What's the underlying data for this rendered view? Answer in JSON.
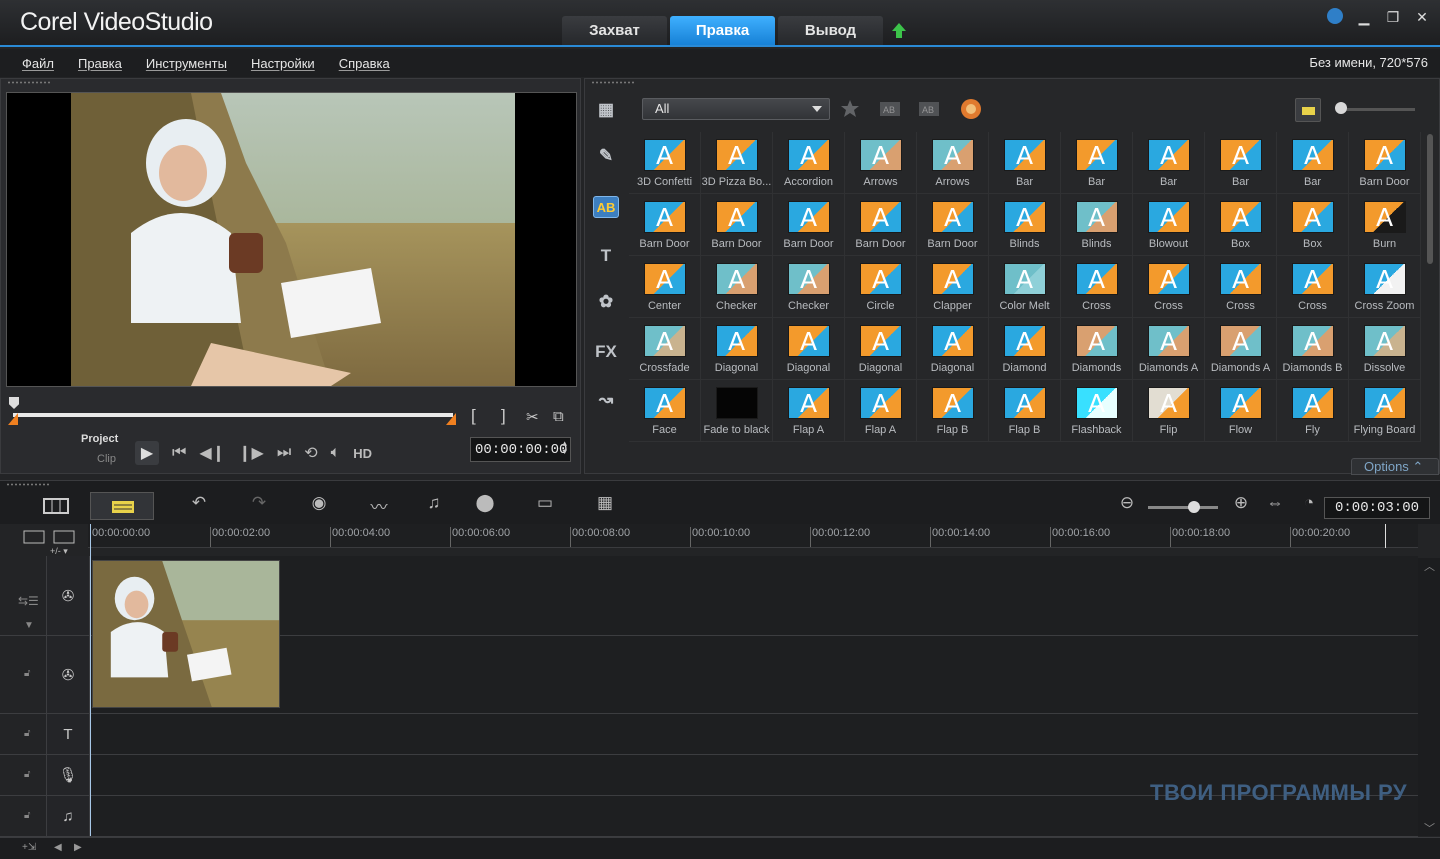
{
  "app": {
    "logo": "Corel VideoStudio"
  },
  "tabs": [
    {
      "label": "Захват"
    },
    {
      "label": "Правка"
    },
    {
      "label": "Вывод"
    }
  ],
  "menu": {
    "items": [
      "Файл",
      "Правка",
      "Инструменты",
      "Настройки",
      "Справка"
    ],
    "project_info": "Без имени, 720*576"
  },
  "player": {
    "project_label": "Project",
    "clip_label": "Clip",
    "hd_label": "HD",
    "timecode": "00:00:00:00",
    "brackets": [
      "[",
      "]"
    ]
  },
  "library": {
    "filter": "All",
    "options_label": "Options",
    "items": [
      {
        "label": "3D Confetti",
        "bg": "#2aa8e0",
        "fg": "#f39a2c"
      },
      {
        "label": "3D Pizza Bo...",
        "bg": "#f39a2c",
        "fg": "#2aa8e0"
      },
      {
        "label": "Accordion",
        "bg": "#2aa8e0",
        "fg": "#f39a2c"
      },
      {
        "label": "Arrows",
        "bg": "#6fbfc9",
        "fg": "#d9a070"
      },
      {
        "label": "Arrows",
        "bg": "#6fbfc9",
        "fg": "#d9a070"
      },
      {
        "label": "Bar",
        "bg": "#2aa8e0",
        "fg": "#f39a2c"
      },
      {
        "label": "Bar",
        "bg": "#f39a2c",
        "fg": "#2aa8e0"
      },
      {
        "label": "Bar",
        "bg": "#2aa8e0",
        "fg": "#f39a2c"
      },
      {
        "label": "Bar",
        "bg": "#f39a2c",
        "fg": "#2aa8e0"
      },
      {
        "label": "Bar",
        "bg": "#2aa8e0",
        "fg": "#f39a2c"
      },
      {
        "label": "Barn Door",
        "bg": "#f39a2c",
        "fg": "#2aa8e0"
      },
      {
        "label": "Barn Door",
        "bg": "#2aa8e0",
        "fg": "#f39a2c"
      },
      {
        "label": "Barn Door",
        "bg": "#f39a2c",
        "fg": "#2aa8e0"
      },
      {
        "label": "Barn Door",
        "bg": "#2aa8e0",
        "fg": "#f39a2c"
      },
      {
        "label": "Barn Door",
        "bg": "#f39a2c",
        "fg": "#2aa8e0"
      },
      {
        "label": "Barn Door",
        "bg": "#f39a2c",
        "fg": "#2aa8e0"
      },
      {
        "label": "Blinds",
        "bg": "#2aa8e0",
        "fg": "#f39a2c"
      },
      {
        "label": "Blinds",
        "bg": "#6fbfc9",
        "fg": "#d9a070"
      },
      {
        "label": "Blowout",
        "bg": "#2aa8e0",
        "fg": "#f39a2c"
      },
      {
        "label": "Box",
        "bg": "#f39a2c",
        "fg": "#2aa8e0"
      },
      {
        "label": "Box",
        "bg": "#f39a2c",
        "fg": "#2aa8e0"
      },
      {
        "label": "Burn",
        "bg": "#f39a2c",
        "fg": "#1a1a1a"
      },
      {
        "label": "Center",
        "bg": "#f39a2c",
        "fg": "#2aa8e0"
      },
      {
        "label": "Checker",
        "bg": "#6fbfc9",
        "fg": "#d9a070"
      },
      {
        "label": "Checker",
        "bg": "#6fbfc9",
        "fg": "#d9a070"
      },
      {
        "label": "Circle",
        "bg": "#f39a2c",
        "fg": "#2aa8e0"
      },
      {
        "label": "Clapper",
        "bg": "#f39a2c",
        "fg": "#2aa8e0"
      },
      {
        "label": "Color Melt",
        "bg": "#6fbfc9",
        "fg": "#8fd0d8"
      },
      {
        "label": "Cross",
        "bg": "#2aa8e0",
        "fg": "#f39a2c"
      },
      {
        "label": "Cross",
        "bg": "#f39a2c",
        "fg": "#2aa8e0"
      },
      {
        "label": "Cross",
        "bg": "#2aa8e0",
        "fg": "#f39a2c"
      },
      {
        "label": "Cross",
        "bg": "#2aa8e0",
        "fg": "#f39a2c"
      },
      {
        "label": "Cross Zoom",
        "bg": "#2aa8e0",
        "fg": "#f2f2f2"
      },
      {
        "label": "Crossfade",
        "bg": "#6fbfc9",
        "fg": "#c9b38f"
      },
      {
        "label": "Diagonal",
        "bg": "#2aa8e0",
        "fg": "#f39a2c"
      },
      {
        "label": "Diagonal",
        "bg": "#f39a2c",
        "fg": "#2aa8e0"
      },
      {
        "label": "Diagonal",
        "bg": "#f39a2c",
        "fg": "#2aa8e0"
      },
      {
        "label": "Diagonal",
        "bg": "#2aa8e0",
        "fg": "#f39a2c"
      },
      {
        "label": "Diamond",
        "bg": "#2aa8e0",
        "fg": "#f39a2c"
      },
      {
        "label": "Diamonds",
        "bg": "#d9a070",
        "fg": "#6fbfc9"
      },
      {
        "label": "Diamonds A",
        "bg": "#6fbfc9",
        "fg": "#d9a070"
      },
      {
        "label": "Diamonds A",
        "bg": "#d9a070",
        "fg": "#6fbfc9"
      },
      {
        "label": "Diamonds B",
        "bg": "#6fbfc9",
        "fg": "#d9a070"
      },
      {
        "label": "Dissolve",
        "bg": "#6fbfc9",
        "fg": "#c9b38f"
      },
      {
        "label": "Face",
        "bg": "#2aa8e0",
        "fg": "#f39a2c"
      },
      {
        "label": "Fade to black",
        "bg": "#050505",
        "fg": "#050505"
      },
      {
        "label": "Flap A",
        "bg": "#2aa8e0",
        "fg": "#f39a2c"
      },
      {
        "label": "Flap A",
        "bg": "#2aa8e0",
        "fg": "#f39a2c"
      },
      {
        "label": "Flap B",
        "bg": "#f39a2c",
        "fg": "#2aa8e0"
      },
      {
        "label": "Flap B",
        "bg": "#2aa8e0",
        "fg": "#f39a2c"
      },
      {
        "label": "Flashback",
        "bg": "#38e0ff",
        "fg": "#e8ffff"
      },
      {
        "label": "Flip",
        "bg": "#e2ddd2",
        "fg": "#f39a2c"
      },
      {
        "label": "Flow",
        "bg": "#2aa8e0",
        "fg": "#f39a2c"
      },
      {
        "label": "Fly",
        "bg": "#2aa8e0",
        "fg": "#f39a2c"
      },
      {
        "label": "Flying Board",
        "bg": "#2aa8e0",
        "fg": "#f39a2c"
      }
    ]
  },
  "timeline": {
    "timecode": "0:00:03:00",
    "ruler": [
      "00:00:00:00",
      "00:00:02:00",
      "00:00:04:00",
      "00:00:06:00",
      "00:00:08:00",
      "00:00:10:00",
      "00:00:12:00",
      "00:00:14:00",
      "00:00:16:00",
      "00:00:18:00",
      "00:00:20:00"
    ]
  },
  "watermark": "ТВОИ ПРОГРАММЫ РУ",
  "colors": {
    "accent": "#2a8ad6",
    "active_tab": "#1f95ec",
    "orange": "#f39a2c",
    "blue": "#2aa8e0"
  }
}
